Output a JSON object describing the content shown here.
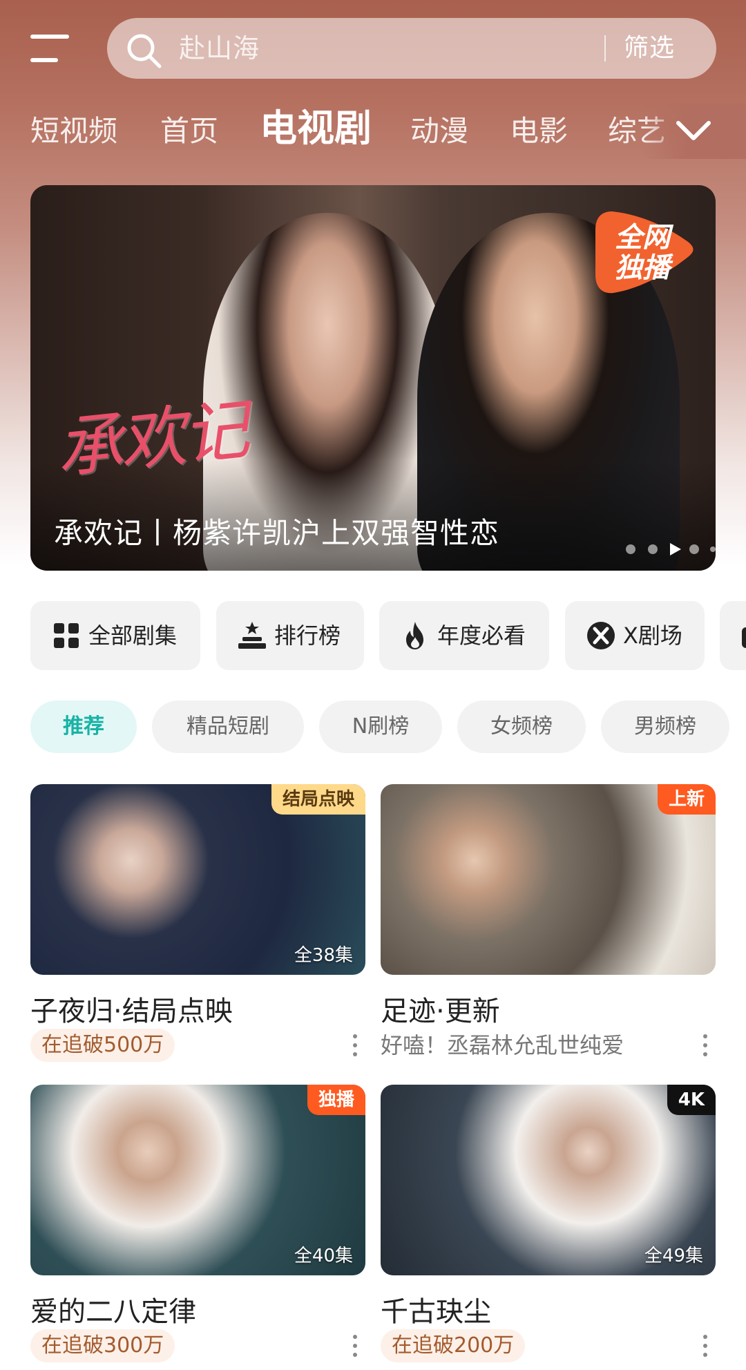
{
  "search": {
    "placeholder": "赴山海",
    "filter_label": "筛选"
  },
  "tabs": [
    {
      "label": "短视频",
      "active": false
    },
    {
      "label": "首页",
      "active": false
    },
    {
      "label": "电视剧",
      "active": true
    },
    {
      "label": "动漫",
      "active": false
    },
    {
      "label": "电影",
      "active": false
    },
    {
      "label": "综艺",
      "active": false
    }
  ],
  "banner": {
    "script_title": "承欢记",
    "caption": "承欢记丨杨紫许凯沪上双强智性恋",
    "badge": "全网独播",
    "dot_count": 5,
    "active_dot": 3
  },
  "quick_links": [
    {
      "label": "全部剧集",
      "icon": "grid-icon"
    },
    {
      "label": "排行榜",
      "icon": "podium-icon"
    },
    {
      "label": "年度必看",
      "icon": "flame-icon"
    },
    {
      "label": "X剧场",
      "icon": "x-theater-icon"
    }
  ],
  "chips": [
    {
      "label": "推荐",
      "active": true
    },
    {
      "label": "精品短剧",
      "active": false
    },
    {
      "label": "N刷榜",
      "active": false
    },
    {
      "label": "女频榜",
      "active": false
    },
    {
      "label": "男频榜",
      "active": false
    }
  ],
  "cards": [
    {
      "title": "子夜归·结局点映",
      "tag": "结局点映",
      "episodes": "全38集",
      "subtitle": "在追破500万",
      "subtitle_style": "pill"
    },
    {
      "title": "足迹·更新",
      "tag": "上新",
      "episodes": "",
      "subtitle": "好嗑！丞磊林允乱世纯爱",
      "subtitle_style": "text"
    },
    {
      "title": "爱的二八定律",
      "tag": "独播",
      "episodes": "全40集",
      "subtitle": "在追破300万",
      "subtitle_style": "pill"
    },
    {
      "title": "千古玦尘",
      "tag": "4K",
      "episodes": "全49集",
      "subtitle": "在追破200万",
      "subtitle_style": "pill"
    }
  ],
  "colors": {
    "accent_teal": "#17b3a5",
    "tag_orange": "#ff5a1f",
    "tag_yellow": "#ffd98a",
    "pill_text": "#a25b2e"
  }
}
